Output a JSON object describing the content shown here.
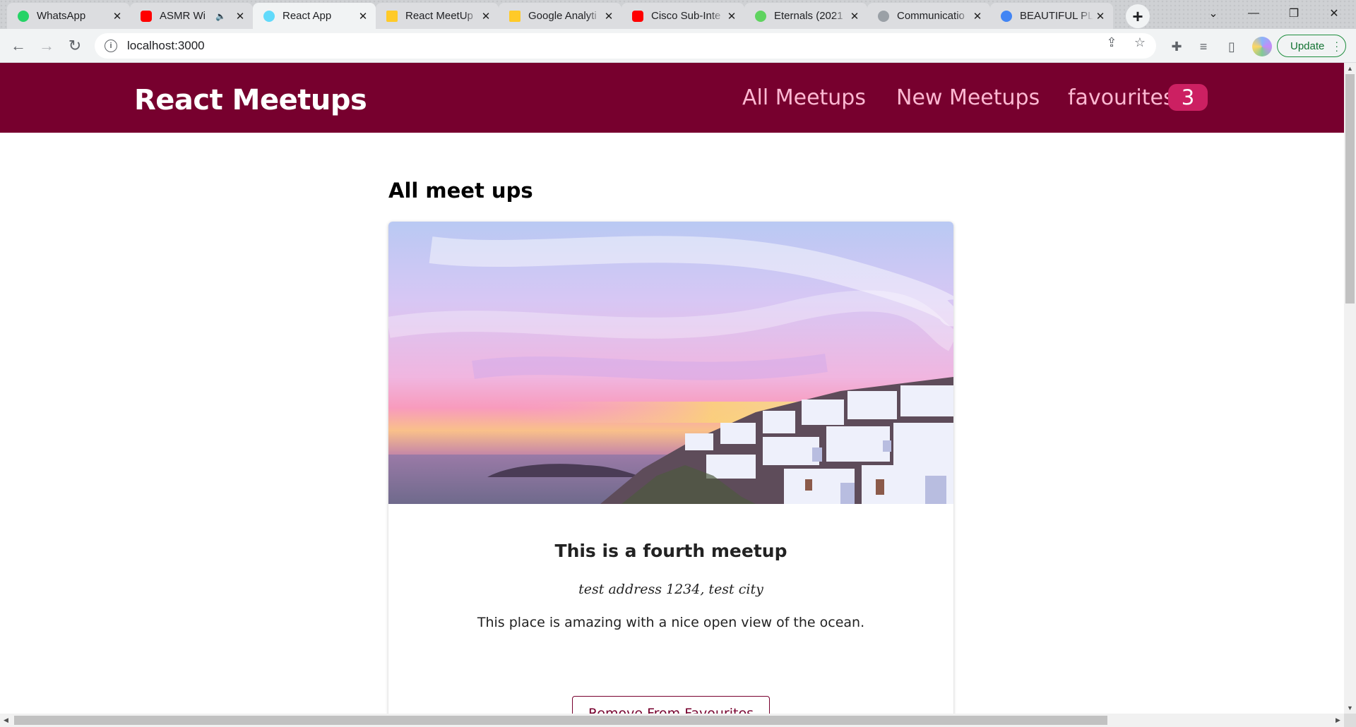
{
  "browser": {
    "tabs": [
      {
        "title": "WhatsApp",
        "icon": "whatsapp-icon",
        "color": "#25d366"
      },
      {
        "title": "ASMR Wi",
        "icon": "youtube-icon",
        "color": "#ff0000",
        "audio": "🔈"
      },
      {
        "title": "React App",
        "icon": "react-icon",
        "color": "#61dafb"
      },
      {
        "title": "React MeetUp",
        "icon": "firebase-icon",
        "color": "#ffca28"
      },
      {
        "title": "Google Analyti",
        "icon": "firebase-icon",
        "color": "#ffca28"
      },
      {
        "title": "Cisco Sub-Inte",
        "icon": "youtube-icon",
        "color": "#ff0000"
      },
      {
        "title": "Eternals (2021",
        "icon": "movie-icon",
        "color": "#5fd35f"
      },
      {
        "title": "Communicatio",
        "icon": "cisco-icon",
        "color": "#9aa0a6"
      },
      {
        "title": "BEAUTIFUL PL",
        "icon": "google-icon",
        "color": "#4285f4"
      }
    ],
    "url": "localhost:3000",
    "update_label": "Update"
  },
  "app": {
    "logo": "React Meetups",
    "nav": {
      "all": "All Meetups",
      "new": "New Meetups",
      "favourites": "favourites",
      "favourites_count": "3"
    },
    "section_title": "All meet ups",
    "meetup": {
      "title": "This is a fourth meetup",
      "address": "test address 1234, test city",
      "description": "This place is amazing with a nice open view of the ocean.",
      "button_label": "Remove From Favourites"
    }
  },
  "colors": {
    "brand": "#77002e",
    "nav_link": "#fcb8d2",
    "badge": "#cc2062"
  }
}
